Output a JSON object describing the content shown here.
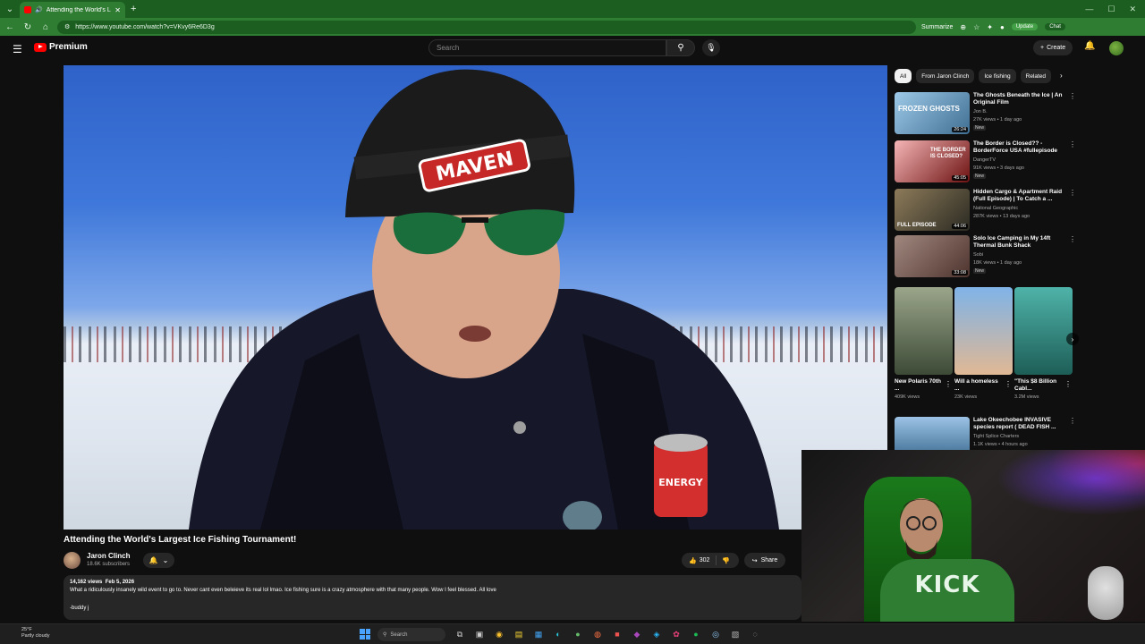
{
  "browser": {
    "tab_title": "Attending the World's Largest",
    "url": "https://www.youtube.com/watch?v=VKvy6Re6D3g",
    "summarize_label": "Summarize",
    "update_label": "Update",
    "chat_label": "Chat"
  },
  "header": {
    "logo_text": "Premium",
    "search_placeholder": "Search",
    "create_label": "Create"
  },
  "video": {
    "title": "Attending the World's Largest Ice Fishing Tournament!",
    "channel_name": "Jaron Clinch",
    "subscribers": "18.6K subscribers",
    "likes": "302",
    "share_label": "Share",
    "views": "14,162 views",
    "date": "Feb 5, 2026",
    "description": "What a ridiculously insanely wild event to go to. Never cant even beleieve its real lol lmao. Ice fishing sure is a crazy atmosphere with that many people. Wow I feel blessed. All love",
    "signature": "-buddy j",
    "hat_text": "MAVEN",
    "can_text": "ENERGY"
  },
  "chips": [
    "All",
    "From Jaron Clinch",
    "Ice fishing",
    "Related"
  ],
  "recommendations": [
    {
      "title": "The Ghosts Beneath the Ice | An Original Film",
      "channel": "Jon B.",
      "meta": "27K views • 1 day ago",
      "badge": "New",
      "duration": "26:24",
      "thumb_text": "FROZEN GHOSTS"
    },
    {
      "title": "The Border is Closed?? - BorderForce USA #fullepisode",
      "channel": "DangerTV",
      "meta": "91K views • 3 days ago",
      "badge": "New",
      "duration": "45:05",
      "thumb_text": "THE BORDER IS CLOSED?"
    },
    {
      "title": "Hidden Cargo & Apartment Raid (Full Episode) | To Catch a ...",
      "channel": "National Geographic",
      "meta": "287K views • 13 days ago",
      "badge": "",
      "duration": "44:06",
      "thumb_text": "FULL EPISODE"
    },
    {
      "title": "Solo Ice Camping in My 14ft Thermal Bunk Shack",
      "channel": "Sobi",
      "meta": "18K views • 1 day ago",
      "badge": "New",
      "duration": "33:08",
      "thumb_text": ""
    }
  ],
  "shorts": [
    {
      "title": "New Polaris 70th ...",
      "views": "409K views"
    },
    {
      "title": "Will a homeless ...",
      "views": "23K views"
    },
    {
      "title": "\"This $8 Billion Cabl...",
      "views": "3.2M views"
    }
  ],
  "last_rec": {
    "title": "Lake Okeechobee INVASIVE species report ( DEAD FISH ...",
    "channel": "Tight Splice Charters",
    "meta": "1.1K views • 4 hours ago"
  },
  "webcam": {
    "shirt_text": "KICK"
  },
  "taskbar": {
    "temp": "25°F",
    "weather": "Partly cloudy",
    "search_label": "Search"
  },
  "colors": {
    "accent_green": "#2e7d32",
    "yt_red": "#ff0000",
    "bg": "#0f0f0f"
  }
}
